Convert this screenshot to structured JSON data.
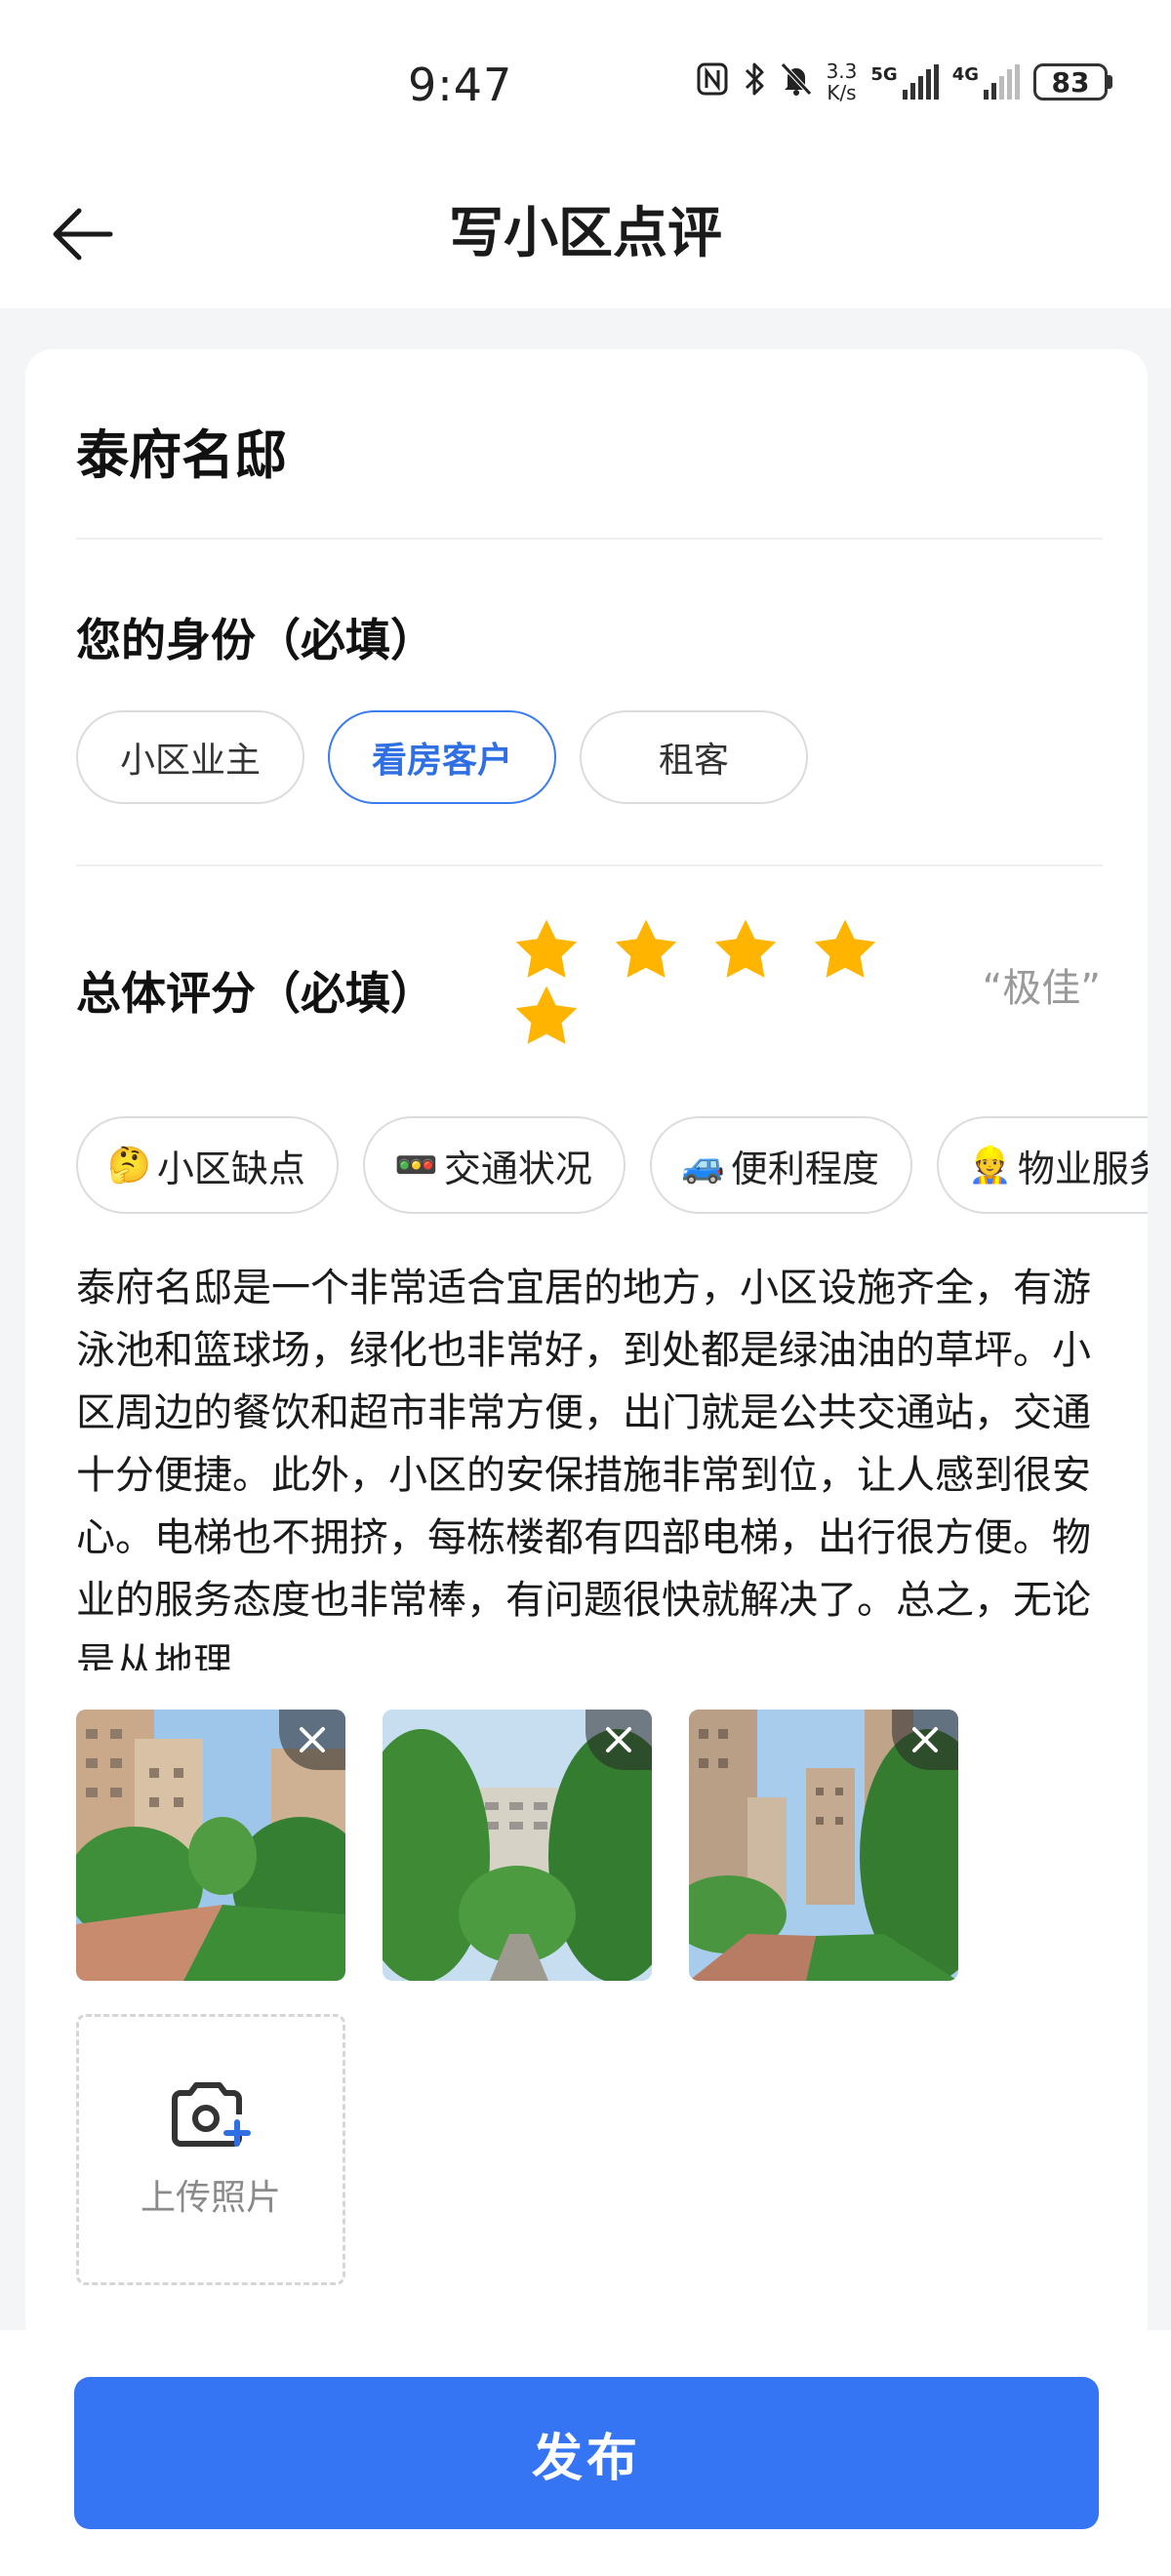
{
  "status_bar": {
    "time": "9:47",
    "net_speed_value": "3.3",
    "net_speed_unit": "K/s",
    "signal1_label": "5G",
    "signal2_label": "4G",
    "battery": "83",
    "icons": [
      "nfc-icon",
      "bluetooth-icon",
      "mute-icon",
      "signal-5g-icon",
      "signal-4g-icon",
      "battery-icon"
    ]
  },
  "header": {
    "title": "写小区点评",
    "back_icon": "arrow-left-icon"
  },
  "community": {
    "name": "泰府名邸"
  },
  "identity": {
    "title": "您的身份（必填）",
    "options": [
      {
        "label": "小区业主",
        "selected": false
      },
      {
        "label": "看房客户",
        "selected": true
      },
      {
        "label": "租客",
        "selected": false
      }
    ]
  },
  "rating": {
    "title": "总体评分（必填）",
    "stars": 5,
    "max": 5,
    "star_color": "#ffb400",
    "label": "“极佳”"
  },
  "tags": [
    {
      "emoji": "🤔",
      "label": "小区缺点"
    },
    {
      "emoji": "🚥",
      "label": "交通状况"
    },
    {
      "emoji": "🚙",
      "label": "便利程度"
    },
    {
      "emoji": "👷",
      "label": "物业服务"
    }
  ],
  "review": {
    "text": "泰府名邸是一个非常适合宜居的地方，小区设施齐全，有游泳池和篮球场，绿化也非常好，到处都是绿油油的草坪。小区周边的餐饮和超市非常方便，出门就是公共交通站，交通十分便捷。此外，小区的安保措施非常到位，让人感到很安心。电梯也不拥挤，每栋楼都有四部电梯，出行很方便。物业的服务态度也非常棒，有问题很快就解决了。总之，无论是从地理"
  },
  "photos": {
    "count": 3,
    "close_icon": "close-icon",
    "upload_label": "上传照片",
    "upload_icon": "camera-add-icon"
  },
  "footer": {
    "publish_label": "发布"
  },
  "colors": {
    "accent": "#3575f4",
    "selected_text": "#2f6fe3",
    "star": "#ffb400"
  }
}
